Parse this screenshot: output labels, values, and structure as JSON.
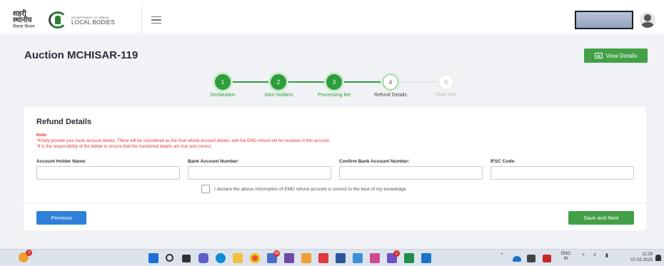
{
  "header": {
    "logo_hindi_line1": "शहरी स्थानीय",
    "logo_hindi_line2": "निकाय विभाग",
    "logo_eng_line1": "DEPARTMENT OF URBAN",
    "logo_eng_line2": "LOCAL BODIES"
  },
  "page": {
    "title": "Auction MCHISAR-119",
    "view_details_label": "View Details"
  },
  "stepper": {
    "steps": [
      {
        "number": "1",
        "label": "Declaration",
        "state": "done"
      },
      {
        "number": "2",
        "label": "Joint Holders",
        "state": "done"
      },
      {
        "number": "3",
        "label": "Processing fee",
        "state": "done"
      },
      {
        "number": "4",
        "label": "Refund Details",
        "state": "current"
      },
      {
        "number": "5",
        "label": "EMD Fee",
        "state": "todo"
      }
    ]
  },
  "refund": {
    "title": "Refund Details",
    "note_heading": "Note:",
    "note_line1": "*Kindly provide your bank account details. These will be considered as the final refund account details, and the EMD refund will be received in this account.",
    "note_line2": "*It is the responsibility of the bidder to ensure that the mentioned details are true and correct.",
    "fields": [
      {
        "label": "Account Holder Name:",
        "value": ""
      },
      {
        "label": "Bank Account Number:",
        "value": ""
      },
      {
        "label": "Confirm Bank Account Number:",
        "value": ""
      },
      {
        "label": "IFSC Code:",
        "value": ""
      }
    ],
    "declaration": "I declare the above information of EMD refund account is correct to the best of my knowledge.",
    "previous_label": "Previous",
    "next_label": "Save and Next"
  },
  "taskbar": {
    "weather_badge": "3",
    "app_badges": {
      "app4": "99",
      "app12": "1"
    },
    "lang_line1": "ENG",
    "lang_line2": "IN",
    "time": "11:29",
    "date": "07-02-2025"
  },
  "colors": {
    "primary_green": "#43a047",
    "step_done": "#2e9e3c",
    "previous_blue": "#2f80d8",
    "note_red": "#e53935"
  }
}
